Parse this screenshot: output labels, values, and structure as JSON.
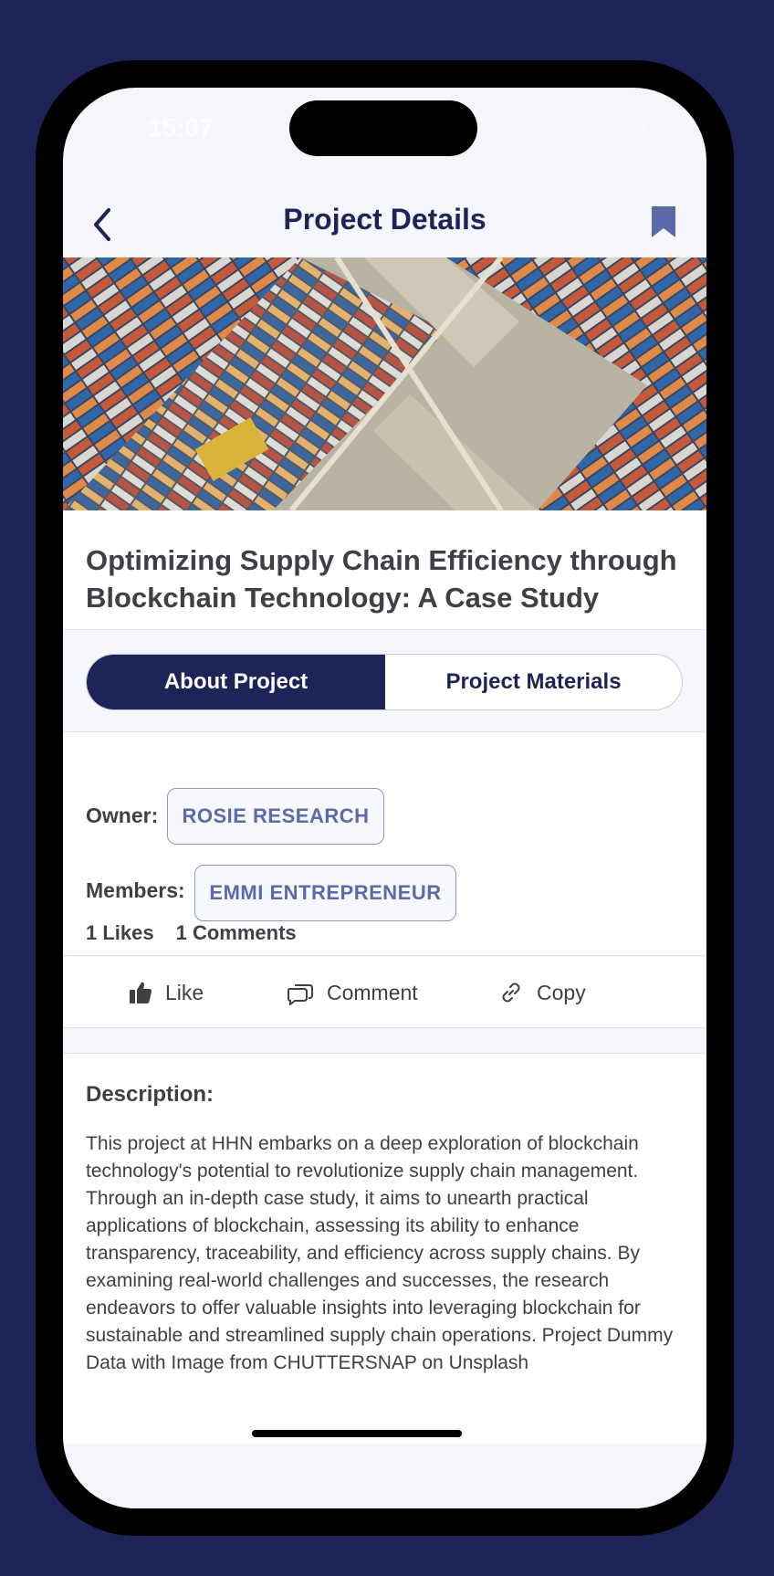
{
  "status_bar": {
    "time": "15:07"
  },
  "nav": {
    "title": "Project Details",
    "back_icon": "chevron-left-icon",
    "bookmark_icon": "bookmark-icon"
  },
  "hero": {
    "alt": "Aerial view of shipping containers at a port"
  },
  "project": {
    "title": "Optimizing Supply Chain Efficiency through Blockchain Technology: A Case Study"
  },
  "tabs": [
    {
      "label": "About Project",
      "active": true
    },
    {
      "label": "Project Materials",
      "active": false
    }
  ],
  "info": {
    "owner_label": "Owner:",
    "owner": "ROSIE RESEARCH",
    "members_label": "Members:",
    "members": [
      "EMMI ENTREPRENEUR"
    ],
    "likes": "1 Likes",
    "comments": "1 Comments"
  },
  "actions": {
    "like": "Like",
    "comment": "Comment",
    "copy": "Copy"
  },
  "description": {
    "heading": "Description:",
    "body": "This project at HHN embarks on a deep exploration of blockchain technology's potential to revolutionize supply chain management. Through an in-depth case study, it aims to unearth practical applications of blockchain, assessing its ability to enhance transparency, traceability, and efficiency across supply chains. By examining real-world challenges and successes, the research endeavors to offer valuable insights into leveraging blockchain for sustainable and streamlined supply chain operations. Project Dummy Data with Image from CHUTTERSNAP on Unsplash"
  },
  "colors": {
    "primary": "#1e2358",
    "chip_text": "#5d6aa8",
    "text": "#3f3f46",
    "background": "#f4f6fb"
  }
}
